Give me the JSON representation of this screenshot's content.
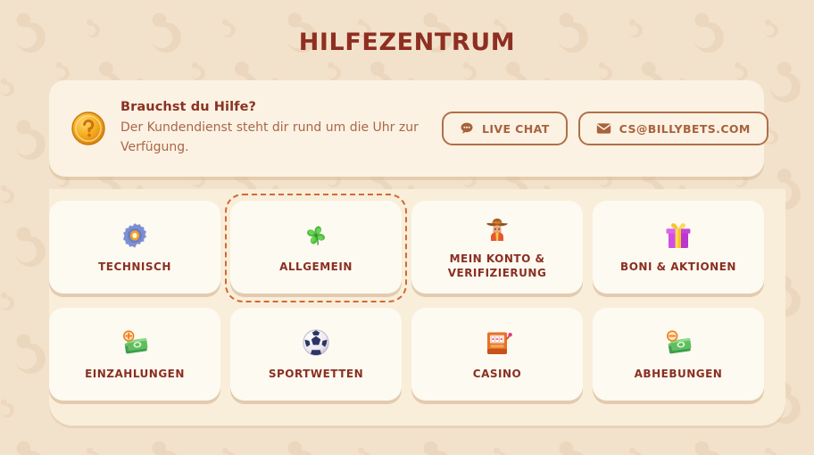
{
  "theme": {
    "background": "#f3e2cb",
    "panel": "#f9eeda",
    "card": "#fdfaf1",
    "banner": "#fcf2e3",
    "title_color": "#8e2f22",
    "label_color": "#8a2f22",
    "body_color": "#a9674a",
    "button_border": "#b06f47",
    "active_outline": "#d06a36"
  },
  "header": {
    "title": "HILFEZENTRUM"
  },
  "support_banner": {
    "icon": "coin-question-icon",
    "heading": "Brauchst du Hilfe?",
    "subtitle": "Der Kundendienst steht dir rund um die Uhr zur Verfügung.",
    "actions": [
      {
        "id": "live-chat",
        "label": "LIVE CHAT",
        "icon": "chat-bubble-icon"
      },
      {
        "id": "email",
        "label": "CS@BILLYBETS.COM",
        "icon": "envelope-icon"
      }
    ]
  },
  "categories": [
    {
      "id": "technisch",
      "label": "TECHNISCH",
      "icon": "gear-icon",
      "active": false
    },
    {
      "id": "allgemein",
      "label": "ALLGEMEIN",
      "icon": "clover-icon",
      "active": true
    },
    {
      "id": "mein-konto",
      "label": "MEIN KONTO & VERIFIZIERUNG",
      "icon": "person-hat-icon",
      "active": false
    },
    {
      "id": "boni",
      "label": "BONI & AKTIONEN",
      "icon": "gift-icon",
      "active": false
    },
    {
      "id": "einzahlungen",
      "label": "EINZAHLUNGEN",
      "icon": "money-plus-icon",
      "active": false
    },
    {
      "id": "sportwetten",
      "label": "SPORTWETTEN",
      "icon": "soccer-ball-icon",
      "active": false
    },
    {
      "id": "casino",
      "label": "CASINO",
      "icon": "slot-machine-icon",
      "active": false
    },
    {
      "id": "abhebungen",
      "label": "ABHEBUNGEN",
      "icon": "money-minus-icon",
      "active": false
    }
  ]
}
